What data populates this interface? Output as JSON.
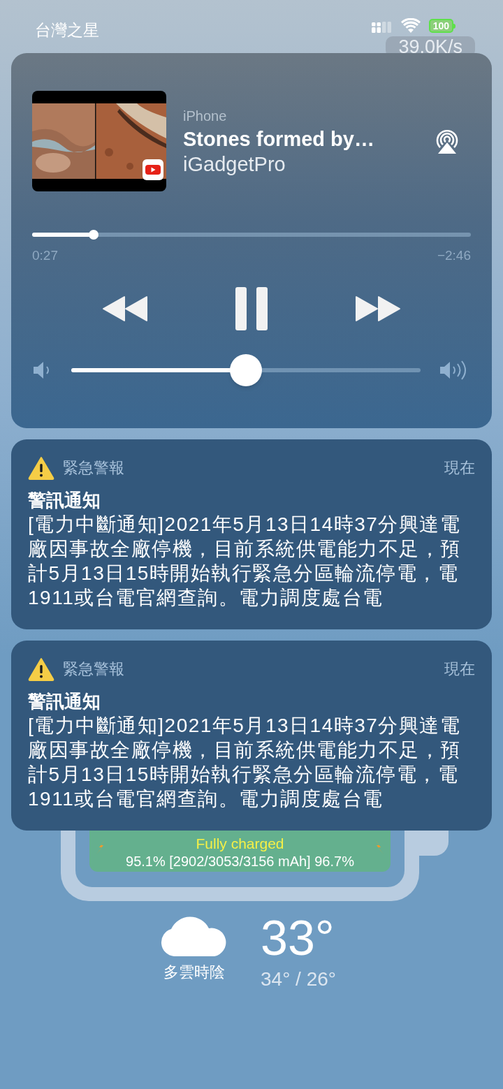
{
  "status_bar": {
    "carrier": "台灣之星",
    "battery": "100",
    "net_speed": "39.0K/s"
  },
  "now_playing": {
    "source": "iPhone",
    "title": "Stones formed by…",
    "artist": "iGadgetPro",
    "progress": {
      "level": 0.14,
      "elapsed": "0:27",
      "remaining": "−2:46"
    },
    "playing": true,
    "volume": {
      "level": 0.5
    }
  },
  "notifications": [
    {
      "app": "緊急警報",
      "time": "現在",
      "title": "警訊通知",
      "body_lines": [
        "[電力中斷通知]2021年5月13日14時37分興達電",
        "廠因事故全廠停機，目前系統供電能力不足，預",
        "計5月13日15時開始執行緊急分區輪流停電，電",
        "1911或台電官網查詢。電力調度處台電"
      ]
    },
    {
      "app": "緊急警報",
      "time": "現在",
      "title": "警訊通知",
      "body_lines": [
        "[電力中斷通知]2021年5月13日14時37分興達電",
        "廠因事故全廠停機，目前系統供電能力不足，預",
        "計5月13日15時開始執行緊急分區輪流停電，電",
        "1911或台電官網查詢。電力調度處台電"
      ]
    }
  ],
  "battery_widget": {
    "status": "Fully charged",
    "details": "95.1% [2902/3053/3156 mAh] 96.7%"
  },
  "weather": {
    "condition": "多雲時陰",
    "temperature": "33°",
    "range": "34° / 26°"
  }
}
